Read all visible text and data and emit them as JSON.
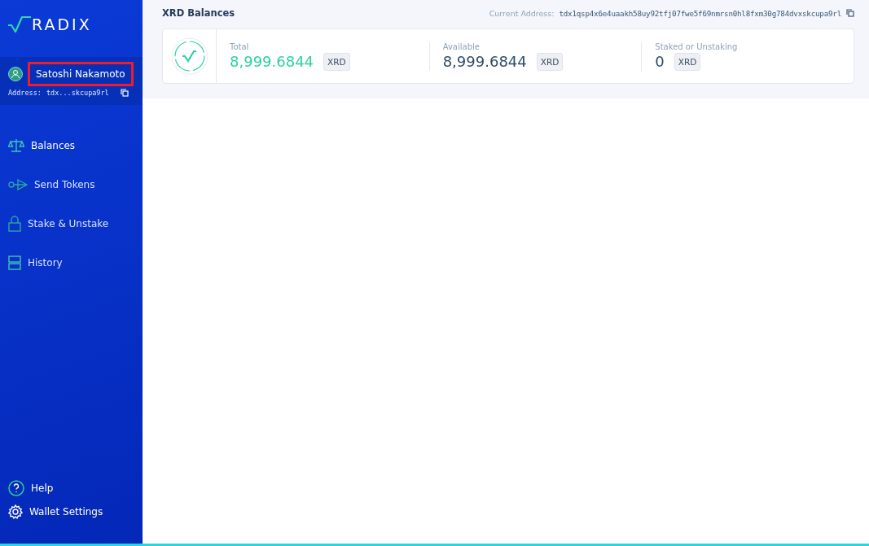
{
  "sidebar": {
    "logo": "RADIX",
    "account": {
      "name": "Satoshi Nakamoto",
      "highlighted": true,
      "address_label": "Address:",
      "address": "tdx...skcupa9rl"
    },
    "nav": [
      {
        "label": "Balances",
        "kind": "scale",
        "selected": true
      },
      {
        "label": "Send Tokens",
        "kind": "send",
        "selected": false
      },
      {
        "label": "Stake & Unstake",
        "kind": "lock",
        "selected": false
      },
      {
        "label": "History",
        "kind": "history",
        "selected": false
      }
    ],
    "footer": [
      {
        "label": "Help",
        "kind": "help"
      },
      {
        "label": "Wallet Settings",
        "kind": "gear"
      }
    ]
  },
  "header": {
    "title": "XRD Balances",
    "address_label": "Current Address:",
    "address": "tdx1qsp4x6e4uaakh58uy92tfj07fwe5f69nmrsn0hl8fxm30g784dvxskcupa9rl"
  },
  "balances": [
    {
      "label": "Total",
      "amount": "8,999.6844",
      "unit": "XRD",
      "accent": true
    },
    {
      "label": "Available",
      "amount": "8,999.6844",
      "unit": "XRD",
      "accent": false
    },
    {
      "label": "Staked or Unstaking",
      "amount": "0",
      "unit": "XRD",
      "accent": false
    }
  ]
}
